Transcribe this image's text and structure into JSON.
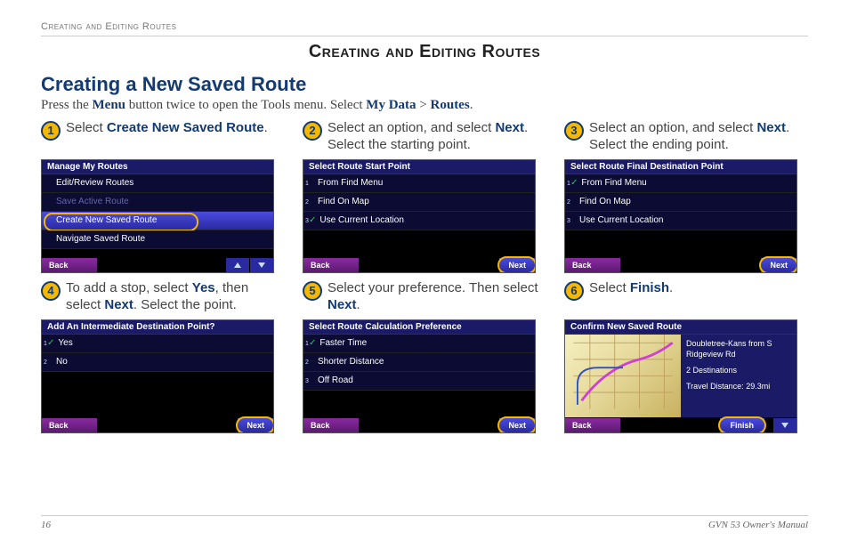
{
  "breadcrumb": "Creating and Editing Routes",
  "page_title": "Creating and Editing Routes",
  "section_title": "Creating a New Saved Route",
  "intro": {
    "t1": "Press the ",
    "b1": "Menu",
    "t2": " button twice to open the Tools menu. Select ",
    "b2": "My Data",
    "t3": " > ",
    "b3": "Routes",
    "t4": "."
  },
  "steps": [
    {
      "num": "1",
      "text_plain": "Select ",
      "text_bold": "Create New Saved Route",
      "text_after": "."
    },
    {
      "num": "2",
      "text_plain": "Select an option, and select ",
      "text_bold": "Next",
      "text_after": ". Select the starting point."
    },
    {
      "num": "3",
      "text_plain": "Select an option, and select ",
      "text_bold": "Next",
      "text_after": ". Select the ending point."
    },
    {
      "num": "4",
      "text_plain": "To add a stop, select ",
      "text_bold": "Yes",
      "text_after": ", then select ",
      "text_bold2": "Next",
      "text_after2": ". Select the point."
    },
    {
      "num": "5",
      "text_plain": "Select your preference. Then select ",
      "text_bold": "Next",
      "text_after": "."
    },
    {
      "num": "6",
      "text_plain": "Select ",
      "text_bold": "Finish",
      "text_after": "."
    }
  ],
  "screens": {
    "s1": {
      "title": "Manage My Routes",
      "items": [
        "Edit/Review Routes",
        "Save Active Route",
        "Create New Saved Route",
        "Navigate Saved Route"
      ],
      "dimIdx": 1,
      "selIdx": 2,
      "circleIdx": 2,
      "back": "Back",
      "hasArrows": true
    },
    "s2": {
      "title": "Select Route Start Point",
      "items": [
        "From Find Menu",
        "Find On Map",
        "Use Current Location"
      ],
      "checkIdx": 2,
      "back": "Back",
      "next": "Next",
      "nextCircle": true
    },
    "s3": {
      "title": "Select Route Final Destination Point",
      "items": [
        "From Find Menu",
        "Find On Map",
        "Use Current Location"
      ],
      "checkIdx": 0,
      "back": "Back",
      "next": "Next",
      "nextCircle": true
    },
    "s4": {
      "title": "Add An Intermediate Destination Point?",
      "items": [
        "Yes",
        "No"
      ],
      "checkIdx": 0,
      "back": "Back",
      "next": "Next",
      "nextCircle": true
    },
    "s5": {
      "title": "Select Route Calculation Preference",
      "items": [
        "Faster Time",
        "Shorter Distance",
        "Off Road"
      ],
      "checkIdx": 0,
      "back": "Back",
      "next": "Next",
      "nextCircle": true
    },
    "s6": {
      "title": "Confirm New Saved Route",
      "back": "Back",
      "finish": "Finish",
      "finishCircle": true,
      "info": [
        "Doubletree-Kans from S Ridgeview Rd",
        "2 Destinations",
        "Travel Distance: 29.3mi"
      ]
    }
  },
  "footer": {
    "page": "16",
    "manual": "GVN 53 Owner's Manual"
  }
}
